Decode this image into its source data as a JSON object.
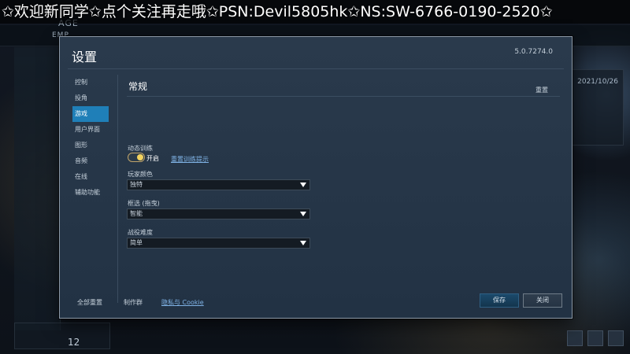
{
  "banner": {
    "text": "✩欢迎新同学✩点个关注再走哦✩PSN:Devil5805hk✩NS:SW-6766-0190-2520✩"
  },
  "background": {
    "logo_top": "AGE",
    "logo_bottom": "EMP",
    "date": "2021/10/26",
    "turn_number": "12"
  },
  "dialog": {
    "title": "设置",
    "version": "5.0.7274.0",
    "sidebar": {
      "items": [
        {
          "label": "控制"
        },
        {
          "label": "投角"
        },
        {
          "label": "游戏"
        },
        {
          "label": "用户界面"
        },
        {
          "label": "图形"
        },
        {
          "label": "音频"
        },
        {
          "label": "在线"
        },
        {
          "label": "辅助功能"
        }
      ],
      "active_index": 2
    },
    "content": {
      "section_title": "常规",
      "reset_label": "重置",
      "dynamic_training_label": "动态训练",
      "toggle_text": "开启",
      "reset_training_link": "重置训练提示",
      "player_color_label": "玩家颜色",
      "player_color_value": "独特",
      "frame_select_label": "框选 (拖曳)",
      "frame_select_value": "智能",
      "campaign_difficulty_label": "战役难度",
      "campaign_difficulty_value": "简单"
    },
    "footer": {
      "reset_all": "全部重置",
      "credits": "制作群",
      "privacy_cookie": "隐私与 Cookie",
      "save": "保存",
      "close": "关闭"
    }
  }
}
